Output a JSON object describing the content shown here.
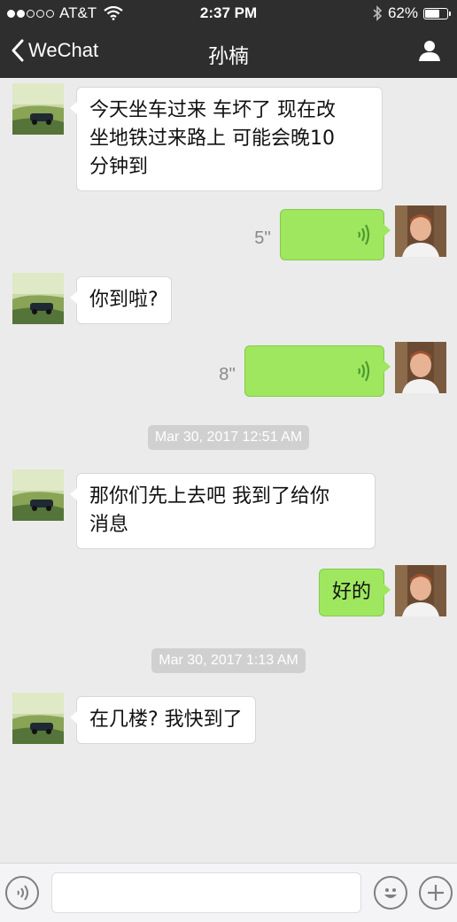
{
  "status_bar": {
    "carrier": "AT&T",
    "time": "2:37 PM",
    "battery": "62%"
  },
  "nav": {
    "back_label": "WeChat",
    "title": "孙楠"
  },
  "messages": [
    {
      "type": "text",
      "side": "in",
      "lines": [
        "今天坐车过来 车坏了 现在改",
        "坐地铁过来路上 可能会晚10",
        "分钟到"
      ]
    },
    {
      "type": "voice",
      "side": "out",
      "duration": "5''"
    },
    {
      "type": "text",
      "side": "in",
      "lines": [
        "你到啦?"
      ]
    },
    {
      "type": "voice",
      "side": "out",
      "duration": "8''"
    },
    {
      "type": "timestamp",
      "text": "Mar 30, 2017 12:51 AM"
    },
    {
      "type": "text",
      "side": "in",
      "lines": [
        "那你们先上去吧 我到了给你",
        "消息"
      ]
    },
    {
      "type": "text",
      "side": "out",
      "lines": [
        "好的"
      ]
    },
    {
      "type": "timestamp",
      "text": "Mar 30, 2017 1:13 AM"
    },
    {
      "type": "text",
      "side": "in",
      "lines": [
        "在几楼? 我快到了"
      ]
    }
  ],
  "input_bar": {
    "text_value": ""
  },
  "colors": {
    "nav_bg": "#2e2e2e",
    "chat_bg": "#ebebeb",
    "outgoing_bubble": "#9ee75f",
    "incoming_bubble": "#ffffff",
    "timestamp_bg": "#d0d0d0"
  },
  "icons": {
    "back": "chevron-left-icon",
    "profile": "person-icon",
    "voice_mode": "voice-icon",
    "emoji": "smiley-icon",
    "more": "plus-icon",
    "voice_wave": "sound-wave-icon"
  }
}
